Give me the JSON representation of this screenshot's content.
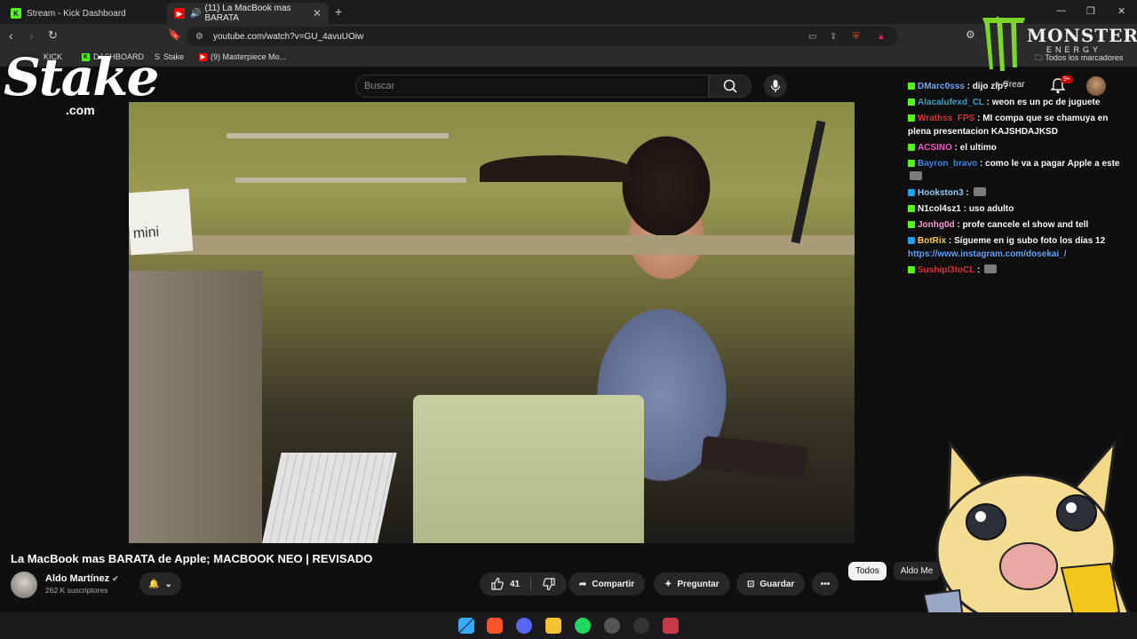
{
  "browser": {
    "tabs": [
      {
        "label": "Stream - Kick Dashboard",
        "active": false
      },
      {
        "label": "(11) La MacBook mas BARATA",
        "active": true
      }
    ],
    "url": "youtube.com/watch?v=GU_4avuUOiw",
    "bookmarks": [
      "KICK",
      "DASHBOARD",
      "Stake",
      "(9) Masterpiece Mo..."
    ],
    "all_bookmarks_label": "Todos los marcadores"
  },
  "youtube": {
    "search_placeholder": "Buscar",
    "create_label": "Crear",
    "notif_count": "9+",
    "video_title": "La MacBook mas BARATA de Apple; MACBOOK NEO | REVISADO",
    "channel_name": "Aldo Martínez",
    "subscribers": "262 K suscriptores",
    "like_count": "41",
    "share_label": "Compartir",
    "ask_label": "Preguntar",
    "save_label": "Guardar",
    "chips": [
      "Todos",
      "Aldo Me"
    ]
  },
  "overlays": {
    "stake_word": "Stake",
    "stake_com": ".com",
    "monster_word": "MONSTER",
    "energy_word": "ENERGY"
  },
  "chat": [
    {
      "user": "DMarc0sss",
      "color": "#6ab0ff",
      "text": "dijo zip?",
      "icon": "kick"
    },
    {
      "user": "Alacalufexd_CL",
      "color": "#2fa8c8",
      "text": "weon es un pc de juguete",
      "icon": "kick"
    },
    {
      "user": "Wrathss_FPS",
      "color": "#d33a3a",
      "text": "MI compa que se chamuya en plena presentacion KAJSHDAJKSD",
      "icon": "kick"
    },
    {
      "user": "ACSINO",
      "color": "#ff5ad1",
      "text": "el ultimo",
      "icon": "kick"
    },
    {
      "user": "Bayron_bravo",
      "color": "#3b8de0",
      "text": "como le va a pagar Apple a este",
      "icon": "kick"
    },
    {
      "user": "Hookston3",
      "color": "#8fd0ff",
      "text": "",
      "icon": "blue"
    },
    {
      "user": "N1col4sz1",
      "color": "#ffffff",
      "text": "uso adulto",
      "icon": "kick"
    },
    {
      "user": "Jonhg0d",
      "color": "#ff9be0",
      "text": "profe cancele el show and tell",
      "icon": "kick"
    },
    {
      "user": "BotRix",
      "color": "#ffd23a",
      "text": "Sígueme en ig subo foto los días 12",
      "link": "https://www.instagram.com/dosekai_/",
      "icon": "blue"
    },
    {
      "user": "Sushipl3toCL",
      "color": "#e03737",
      "text": "",
      "icon": "kick"
    }
  ]
}
